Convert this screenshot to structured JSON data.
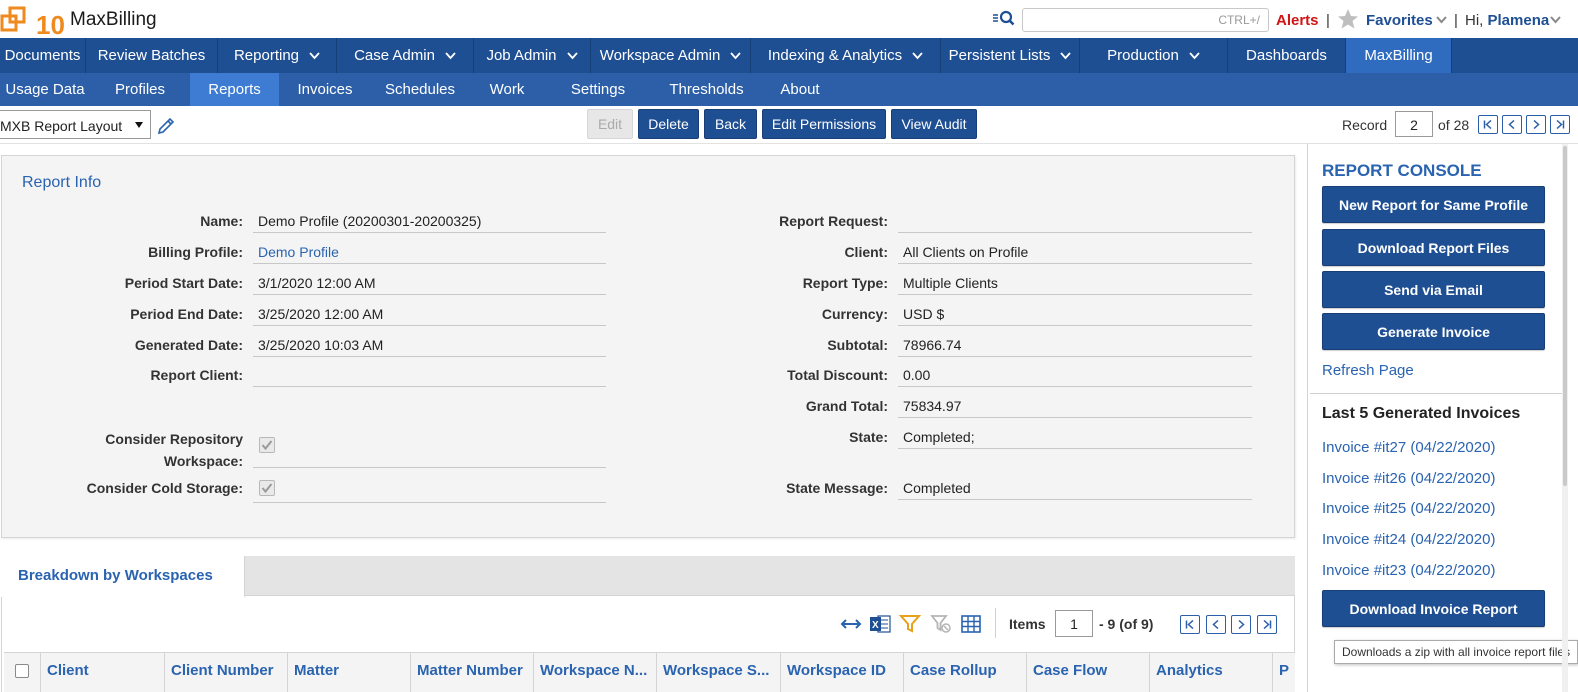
{
  "header": {
    "app_name": "MaxBilling",
    "logo_text": "10",
    "search_placeholder": "CTRL+/",
    "alerts": "Alerts",
    "separator": "|",
    "favorites": "Favorites",
    "greeting": "Hi, ",
    "user_name": "Plamena"
  },
  "main_nav": [
    {
      "label": "Documents",
      "has_menu": false
    },
    {
      "label": "Review Batches",
      "has_menu": false
    },
    {
      "label": "Reporting",
      "has_menu": true
    },
    {
      "label": "Case Admin",
      "has_menu": true
    },
    {
      "label": "Job Admin",
      "has_menu": true
    },
    {
      "label": "Workspace Admin",
      "has_menu": true
    },
    {
      "label": "Indexing & Analytics",
      "has_menu": true
    },
    {
      "label": "Persistent Lists",
      "has_menu": true
    },
    {
      "label": "Production",
      "has_menu": true
    },
    {
      "label": "Dashboards",
      "has_menu": false
    },
    {
      "label": "MaxBilling",
      "has_menu": false,
      "active": true
    }
  ],
  "sub_nav": [
    {
      "label": "Usage Data"
    },
    {
      "label": "Profiles"
    },
    {
      "label": "Reports",
      "active": true
    },
    {
      "label": "Invoices"
    },
    {
      "label": "Schedules"
    },
    {
      "label": "Work"
    },
    {
      "label": "Settings"
    },
    {
      "label": "Thresholds"
    },
    {
      "label": "About"
    }
  ],
  "toolbar": {
    "layout": "MXB Report Layout",
    "edit": "Edit",
    "delete": "Delete",
    "back": "Back",
    "edit_permissions": "Edit Permissions",
    "view_audit": "View Audit",
    "record_label": "Record",
    "record_value": "2",
    "record_of": "of 28"
  },
  "report_info": {
    "title": "Report Info",
    "left": [
      {
        "label": "Name:",
        "value": "Demo Profile (20200301-20200325)"
      },
      {
        "label": "Billing Profile:",
        "value": "Demo Profile",
        "link": true
      },
      {
        "label": "Period Start Date:",
        "value": "3/1/2020 12:00 AM"
      },
      {
        "label": "Period End Date:",
        "value": "3/25/2020 12:00 AM"
      },
      {
        "label": "Generated Date:",
        "value": "3/25/2020 10:03 AM"
      },
      {
        "label": "Report Client:",
        "value": ""
      }
    ],
    "consider_repo_label_1": "Consider Repository",
    "consider_repo_label_2": "Workspace:",
    "consider_repo_checked": true,
    "consider_cold_label": "Consider Cold Storage:",
    "consider_cold_checked": true,
    "right": [
      {
        "label": "Report Request:",
        "value": ""
      },
      {
        "label": "Client:",
        "value": "All Clients on Profile"
      },
      {
        "label": "Report Type:",
        "value": "Multiple Clients"
      },
      {
        "label": "Currency:",
        "value": "USD $"
      },
      {
        "label": "Subtotal:",
        "value": "78966.74"
      },
      {
        "label": "Total Discount:",
        "value": "0.00"
      },
      {
        "label": "Grand Total:",
        "value": "75834.97"
      },
      {
        "label": "State:",
        "value": "Completed;"
      }
    ],
    "state_message_label": "State Message:",
    "state_message_value": "Completed"
  },
  "breakdown": {
    "tab": "Breakdown by Workspaces",
    "items_label": "Items",
    "items_page": "1",
    "items_range": "- 9  (of  9)",
    "columns": [
      "Client",
      "Client Number",
      "Matter",
      "Matter Number",
      "Workspace N...",
      "Workspace S...",
      "Workspace ID",
      "Case Rollup",
      "Case Flow",
      "Analytics",
      "P"
    ]
  },
  "console": {
    "title": "REPORT CONSOLE",
    "buttons": [
      "New Report for Same Profile",
      "Download Report Files",
      "Send via Email",
      "Generate Invoice"
    ],
    "refresh": "Refresh Page",
    "last5_title": "Last 5 Generated Invoices",
    "invoices": [
      "Invoice #it27 (04/22/2020)",
      "Invoice #it26 (04/22/2020)",
      "Invoice #it25 (04/22/2020)",
      "Invoice #it24 (04/22/2020)",
      "Invoice #it23 (04/22/2020)"
    ],
    "download_invoice": "Download Invoice Report",
    "tooltip": "Downloads a zip with all invoice report files"
  },
  "colors": {
    "nav_bg": "#1f4f93",
    "subnav_bg": "#2c5fa8",
    "active_tab": "#2f6cc0",
    "link": "#2a63b0",
    "alert": "#d01515",
    "logo_orange": "#f08a1e"
  }
}
